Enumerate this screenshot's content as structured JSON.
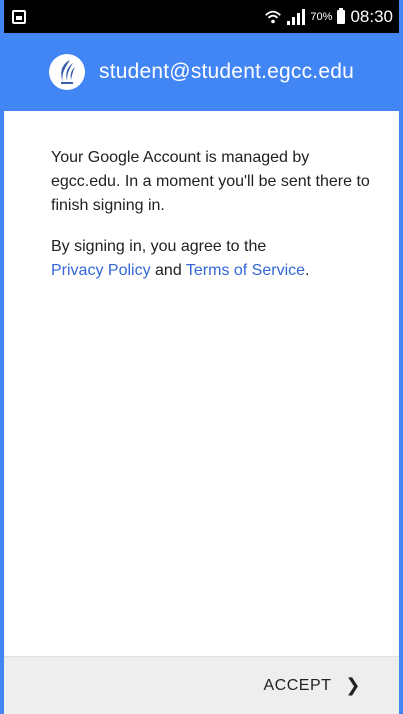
{
  "status_bar": {
    "battery_percent": "70%",
    "time": "08:30",
    "icons": [
      "gallery-notification-icon",
      "wifi-icon",
      "signal-icon",
      "battery-icon"
    ]
  },
  "header": {
    "account_email": "student@student.egcc.edu",
    "logo_icon": "egcc-flame-logo",
    "background_color": "#4285f4"
  },
  "content": {
    "managed_message": "Your Google Account is managed by egcc.edu. In a moment you'll be sent there to finish signing in.",
    "agree_prefix": "By signing in, you agree to the",
    "privacy_link": "Privacy Policy",
    "and_text": "and",
    "terms_link": "Terms of Service",
    "period": ".",
    "link_color": "#3367d6"
  },
  "footer": {
    "accept_label": "ACCEPT",
    "accept_icon": "chevron-right-icon"
  }
}
